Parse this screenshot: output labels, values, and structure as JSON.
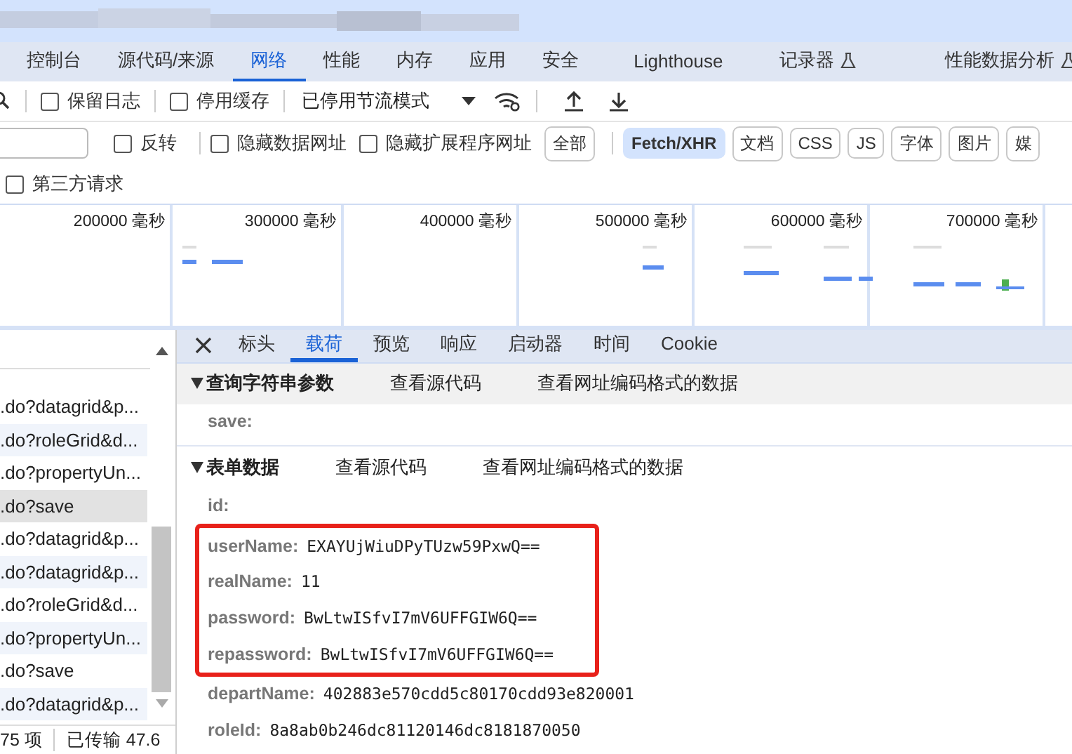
{
  "panel_tabs": [
    {
      "label": "控制台",
      "selected": false,
      "experimental": false
    },
    {
      "label": "源代码/来源",
      "selected": false,
      "experimental": false
    },
    {
      "label": "网络",
      "selected": true,
      "experimental": false
    },
    {
      "label": "性能",
      "selected": false,
      "experimental": false
    },
    {
      "label": "内存",
      "selected": false,
      "experimental": false
    },
    {
      "label": "应用",
      "selected": false,
      "experimental": false
    },
    {
      "label": "安全",
      "selected": false,
      "experimental": false
    },
    {
      "label": "Lighthouse",
      "selected": false,
      "experimental": false
    },
    {
      "label": "记录器",
      "selected": false,
      "experimental": true
    },
    {
      "label": "性能数据分析",
      "selected": false,
      "experimental": true
    }
  ],
  "toolbar": {
    "checkboxes": [
      {
        "label": "保留日志",
        "checked": false
      },
      {
        "label": "停用缓存",
        "checked": false
      }
    ],
    "throttling": "已停用节流模式"
  },
  "filters": {
    "checkboxes": [
      {
        "label": "反转",
        "checked": false
      },
      {
        "label": "隐藏数据网址",
        "checked": false
      },
      {
        "label": "隐藏扩展程序网址",
        "checked": false
      }
    ],
    "chips": [
      {
        "label": "全部",
        "selected": false
      },
      {
        "label": "Fetch/XHR",
        "selected": true
      },
      {
        "label": "文档",
        "selected": false
      },
      {
        "label": "CSS",
        "selected": false
      },
      {
        "label": "JS",
        "selected": false
      },
      {
        "label": "字体",
        "selected": false
      },
      {
        "label": "图片",
        "selected": false
      },
      {
        "label": "媒",
        "selected": false
      }
    ],
    "third_party": {
      "label": "第三方请求",
      "checked": false
    }
  },
  "timeline": {
    "ticks": [
      "200000 毫秒",
      "300000 毫秒",
      "400000 毫秒",
      "500000 毫秒",
      "600000 毫秒",
      "700000 毫秒"
    ]
  },
  "requests": [
    {
      "name": ".do?datagrid&p...",
      "selected": false
    },
    {
      "name": ".do?roleGrid&d...",
      "selected": false
    },
    {
      "name": ".do?propertyUn...",
      "selected": false
    },
    {
      "name": ".do?save",
      "selected": true
    },
    {
      "name": ".do?datagrid&p...",
      "selected": false
    },
    {
      "name": ".do?datagrid&p...",
      "selected": false
    },
    {
      "name": ".do?roleGrid&d...",
      "selected": false
    },
    {
      "name": ".do?propertyUn...",
      "selected": false
    },
    {
      "name": ".do?save",
      "selected": false
    },
    {
      "name": ".do?datagrid&p...",
      "selected": false
    }
  ],
  "status_bar": {
    "count": "75 项",
    "transferred": "已传输 47.6"
  },
  "detail_tabs": [
    {
      "label": "标头",
      "selected": false
    },
    {
      "label": "载荷",
      "selected": true
    },
    {
      "label": "预览",
      "selected": false
    },
    {
      "label": "响应",
      "selected": false
    },
    {
      "label": "启动器",
      "selected": false
    },
    {
      "label": "时间",
      "selected": false
    },
    {
      "label": "Cookie",
      "selected": false
    }
  ],
  "sections": [
    {
      "title": "查询字符串参数",
      "expanded": true,
      "hovered": true,
      "view_source": "查看源代码",
      "view_encoded": "查看网址编码格式的数据",
      "fields": [
        {
          "key": "save:",
          "highlighted": false
        }
      ]
    },
    {
      "title": "表单数据",
      "expanded": true,
      "hovered": false,
      "view_source": "查看源代码",
      "view_encoded": "查看网址编码格式的数据",
      "fields": [
        {
          "key": "id:",
          "highlighted": false
        },
        {
          "key": "userName:",
          "value": "EXAYUjWiuDPyTUzw59PxwQ==",
          "highlighted": true
        },
        {
          "key": "realName:",
          "value": "11",
          "highlighted": true
        },
        {
          "key": "password:",
          "value": "BwLtwISfvI7mV6UFFGIW6Q==",
          "highlighted": true
        },
        {
          "key": "repassword:",
          "value": "BwLtwISfvI7mV6UFFGIW6Q==",
          "highlighted": true
        },
        {
          "key": "departName:",
          "value": "402883e570cdd5c80170cdd93e820001",
          "highlighted": false
        },
        {
          "key": "roleId:",
          "value": "8a8ab0b246dc81120146dc8181870050",
          "highlighted": false
        }
      ]
    }
  ]
}
